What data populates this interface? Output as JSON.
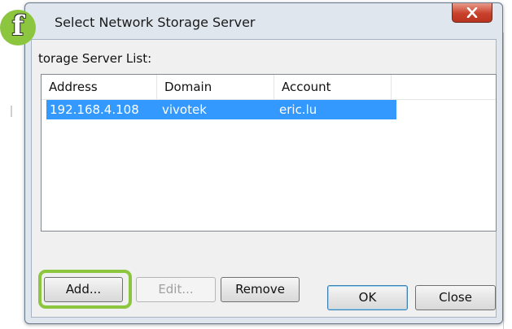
{
  "dialog": {
    "title": "Select Network Storage Server",
    "list_label": "torage Server List:"
  },
  "list": {
    "columns": [
      "Address",
      "Domain",
      "Account"
    ],
    "rows": [
      {
        "address": "192.168.4.108",
        "domain": "vivotek",
        "account": "eric.lu",
        "selected": true
      }
    ]
  },
  "buttons": {
    "add": "Add...",
    "edit": "Edit...",
    "remove": "Remove",
    "ok": "OK",
    "close": "Close"
  },
  "badge": {
    "label": "f"
  },
  "colors": {
    "accent_green": "#8cc63f",
    "selection_blue": "#3399ff",
    "close_red": "#c8412b"
  }
}
